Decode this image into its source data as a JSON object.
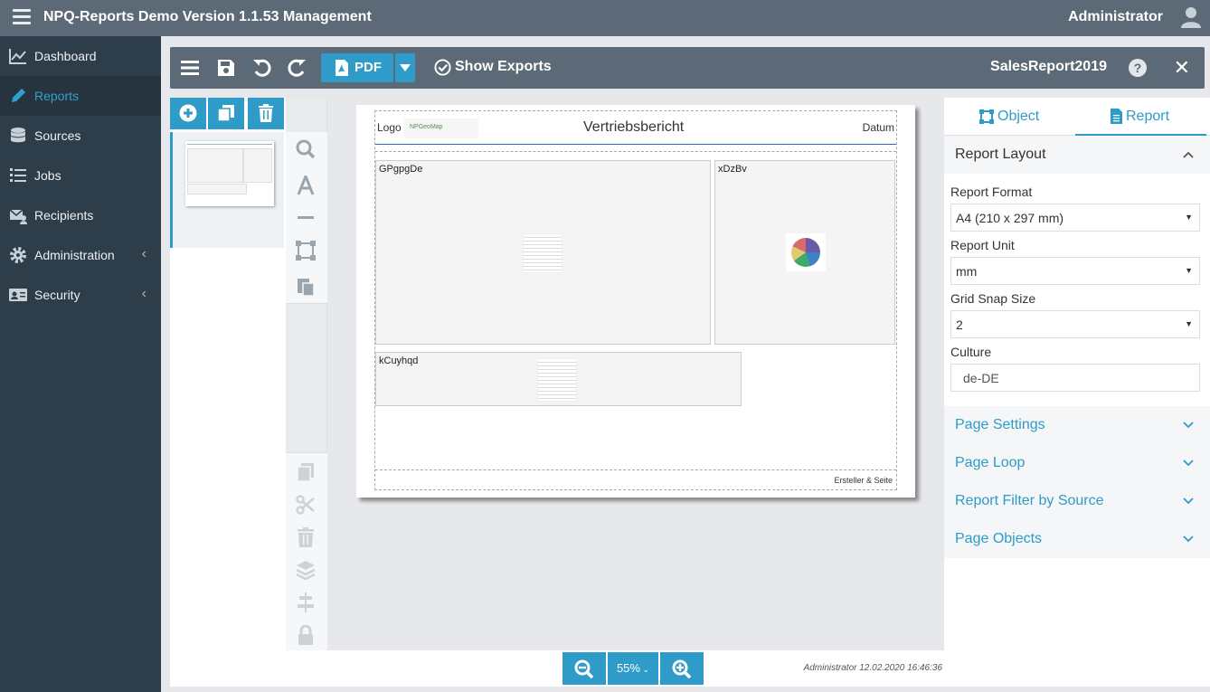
{
  "app": {
    "title": "NPQ-Reports Demo Version 1.1.53 Management",
    "user": "Administrator"
  },
  "sidebar": {
    "items": [
      {
        "label": "Dashboard"
      },
      {
        "label": "Reports"
      },
      {
        "label": "Sources"
      },
      {
        "label": "Jobs"
      },
      {
        "label": "Recipients"
      },
      {
        "label": "Administration"
      },
      {
        "label": "Security"
      }
    ],
    "active_color": "#30a0cc"
  },
  "toolbar": {
    "pdf_label": "PDF",
    "show_exports_label": "Show Exports",
    "report_name": "SalesReport2019",
    "help_symbol": "?"
  },
  "report": {
    "logo_label": "Logo",
    "logo_image_text": "NPGeoMap",
    "title": "Vertriebsbericht",
    "date_label": "Datum",
    "objects": [
      {
        "caption": "GPgpgDe"
      },
      {
        "caption": "xDzBv"
      },
      {
        "caption": "kCuyhqd"
      }
    ],
    "footer_text": "Ersteller & Seite"
  },
  "zoom": {
    "value": "55%"
  },
  "status": {
    "stamp": "Administrator 12.02.2020 16:46:36"
  },
  "props": {
    "tabs": [
      {
        "label": "Object"
      },
      {
        "label": "Report"
      }
    ],
    "layout_section": "Report Layout",
    "fields": {
      "format_label": "Report Format",
      "format_value": "A4 (210 x 297 mm)",
      "unit_label": "Report Unit",
      "unit_value": "mm",
      "snap_label": "Grid Snap Size",
      "snap_value": "2",
      "culture_label": "Culture",
      "culture_value": "de-DE"
    },
    "sections": [
      {
        "label": "Page Settings"
      },
      {
        "label": "Page Loop"
      },
      {
        "label": "Report Filter by Source"
      },
      {
        "label": "Page Objects"
      }
    ]
  },
  "colors": {
    "accent": "#2e9bc8",
    "topbar": "#5c6a77",
    "sidebar": "#2e3d4a"
  }
}
